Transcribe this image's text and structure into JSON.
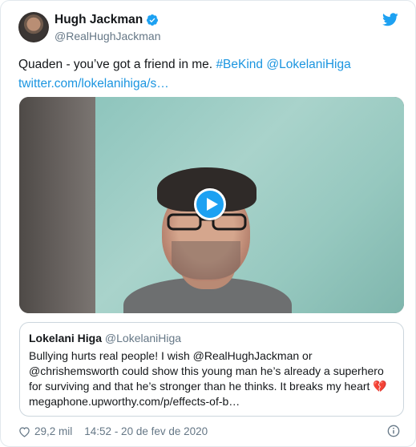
{
  "author": {
    "name": "Hugh Jackman",
    "handle": "@RealHughJackman",
    "verified": true
  },
  "tweet": {
    "text_plain": "Quaden - you’ve got a friend in me.",
    "hashtag": "#BeKind",
    "mention": "@LokelaniHiga",
    "link": "twitter.com/lokelanihiga/s…"
  },
  "media": {
    "type": "video",
    "play_icon": "play-icon"
  },
  "quoted_tweet": {
    "name": "Lokelani Higa",
    "handle": "@LokelaniHiga",
    "text_line1": "Bullying hurts real people! I wish @RealHughJackman or",
    "text_line2": "@chrishemsworth could show this young man he’s already a superhero",
    "text_line3": "for surviving and that he’s stronger than he thinks. It breaks my heart",
    "emoji": "💔",
    "link": "megaphone.upworthy.com/p/effects-of-b…"
  },
  "footer": {
    "likes": "29,2 mil",
    "timestamp": "14:52 - 20 de fev de 2020"
  },
  "colors": {
    "link": "#1b95e0",
    "brand": "#1da1f2",
    "secondary_text": "#657786"
  }
}
